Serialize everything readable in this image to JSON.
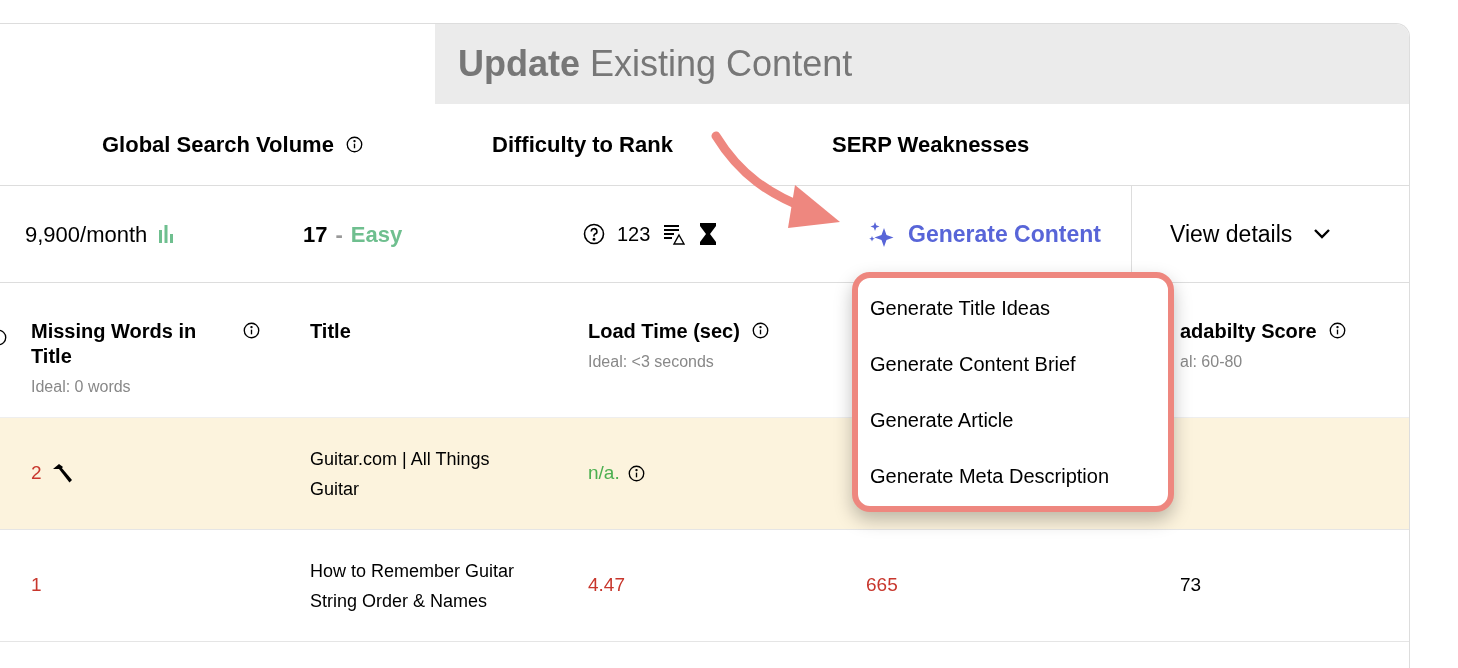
{
  "header": {
    "title_bold": "Update",
    "title_rest": "Existing Content"
  },
  "metrics": [
    {
      "label": "Global Search Volume",
      "info": true
    },
    {
      "label": "Difficulty to Rank",
      "info": false
    },
    {
      "label": "SERP Weaknesses",
      "info": false
    }
  ],
  "summary": {
    "volume": "9,900/month",
    "difficulty_score": "17",
    "separator": "-",
    "difficulty_label": "Easy",
    "weakness_count": "123",
    "generate": "Generate Content",
    "details": "View details"
  },
  "menu": {
    "open": true,
    "items": [
      "Generate Title Ideas",
      "Generate Content Brief",
      "Generate Article",
      "Generate Meta Description"
    ]
  },
  "columns": [
    {
      "label": "Missing Words in Title",
      "ideal": "Ideal: 0 words",
      "info": true
    },
    {
      "label": "Title",
      "info": false
    },
    {
      "label": "Load Time (sec)",
      "ideal": "Ideal: <3 seconds",
      "info": true
    },
    {
      "label": "adabilty Score",
      "ideal": "al: 60-80",
      "info": true
    }
  ],
  "rows": [
    {
      "highlighted": true,
      "missing": {
        "text": "2",
        "color": "#c8372d",
        "tool": true
      },
      "title": "Guitar.com | All Things Guitar",
      "load_time": {
        "text": "n/a.",
        "color": "#4caf50",
        "info": true
      }
    },
    {
      "highlighted": false,
      "missing": {
        "text": "1",
        "color": "#c8372d",
        "tool": false
      },
      "title": "How to Remember Guitar String Order & Names",
      "load_time": {
        "text": "4.47",
        "color": "#c8372d",
        "info": false
      },
      "column_4": {
        "text": "665",
        "color": "#c8372d"
      },
      "readability": {
        "text": "73",
        "color": "#000000"
      }
    }
  ]
}
